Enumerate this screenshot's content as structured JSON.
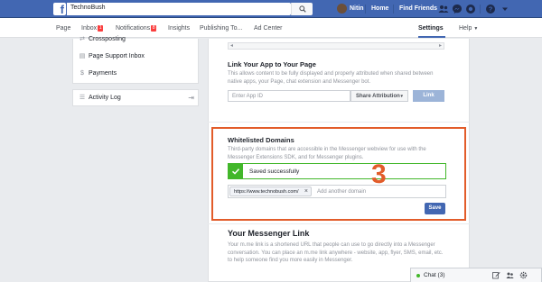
{
  "topbar": {
    "search_value": "TechnoBush",
    "user_name": "Nitin",
    "home": "Home",
    "find_friends": "Find Friends"
  },
  "pagenav": {
    "page": "Page",
    "inbox": "Inbox",
    "inbox_badge": "1",
    "notifications": "Notifications",
    "notifications_badge": "8",
    "insights": "Insights",
    "publishing": "Publishing To...",
    "ad_center": "Ad Center",
    "settings": "Settings",
    "help": "Help"
  },
  "left": {
    "crossposting": "Crossposting",
    "support_inbox": "Page Support Inbox",
    "payments": "Payments",
    "activity_log": "Activity Log"
  },
  "link_app": {
    "title": "Link Your App to Your Page",
    "desc": "This allows content to be fully displayed and properly attributed when shared between native apps, your Page, chat extension and Messenger bot.",
    "placeholder": "Enter App ID",
    "share_attribution": "Share Attribution",
    "link_button": "Link"
  },
  "whitelist": {
    "title": "Whitelisted Domains",
    "desc": "Third-party domains that are accessible in the Messenger webview for use with the Messenger Extensions SDK, and for Messenger plugins.",
    "success": "Saved successfully",
    "domain": "https://www.technobush.com/",
    "add_placeholder": "Add another domain",
    "save_button": "Save",
    "annotation": "3"
  },
  "messenger_link": {
    "title": "Your Messenger Link",
    "desc": "Your m.me link is a shortened URL that people can use to go directly into a Messenger conversation. You can place an m.me link anywhere - website, app, flyer, SMS, email, etc. to help someone find you more easily in Messenger."
  },
  "chat": {
    "label": "Chat (3)"
  },
  "colors": {
    "brand": "#4267b2",
    "success": "#42b72a",
    "annotation": "#e25c2a"
  }
}
